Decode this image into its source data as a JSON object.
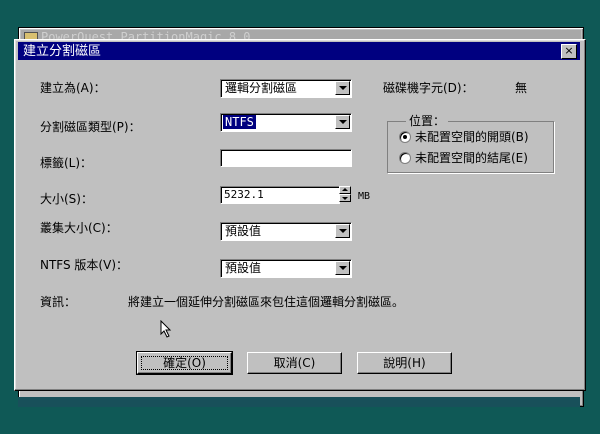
{
  "background_window": {
    "title": "PowerQuest PartitionMagic 8.0"
  },
  "dialog": {
    "title": "建立分割磁區",
    "close_label": "×",
    "fields": {
      "create_as": {
        "label": "建立為(A)：",
        "value": "邏輯分割磁區"
      },
      "partition_type": {
        "label": "分割磁區類型(P)：",
        "value": "NTFS"
      },
      "label": {
        "label": "標籤(L)：",
        "value": ""
      },
      "size": {
        "label": "大小(S)：",
        "value": "5232.1",
        "unit": "MB"
      },
      "cluster_size": {
        "label": "叢集大小(C)：",
        "value": "預設值"
      },
      "ntfs_version": {
        "label": "NTFS 版本(V)：",
        "value": "預設值"
      }
    },
    "drive_letter": {
      "label": "磁碟機字元(D)：",
      "value": "無"
    },
    "position": {
      "legend": "位置：",
      "options": [
        {
          "label": "未配置空間的開頭(B)",
          "checked": true
        },
        {
          "label": "未配置空間的結尾(E)",
          "checked": false
        }
      ]
    },
    "info": {
      "label": "資訊：",
      "text": "將建立一個延伸分割磁區來包住這個邏輯分割磁區。"
    },
    "buttons": {
      "ok": "確定(O)",
      "cancel": "取消(C)",
      "help": "說明(H)"
    }
  },
  "colors": {
    "desktop": "#0f5956",
    "titlebar": "#000080",
    "face": "#c0c0c0",
    "selection": "#000080"
  }
}
